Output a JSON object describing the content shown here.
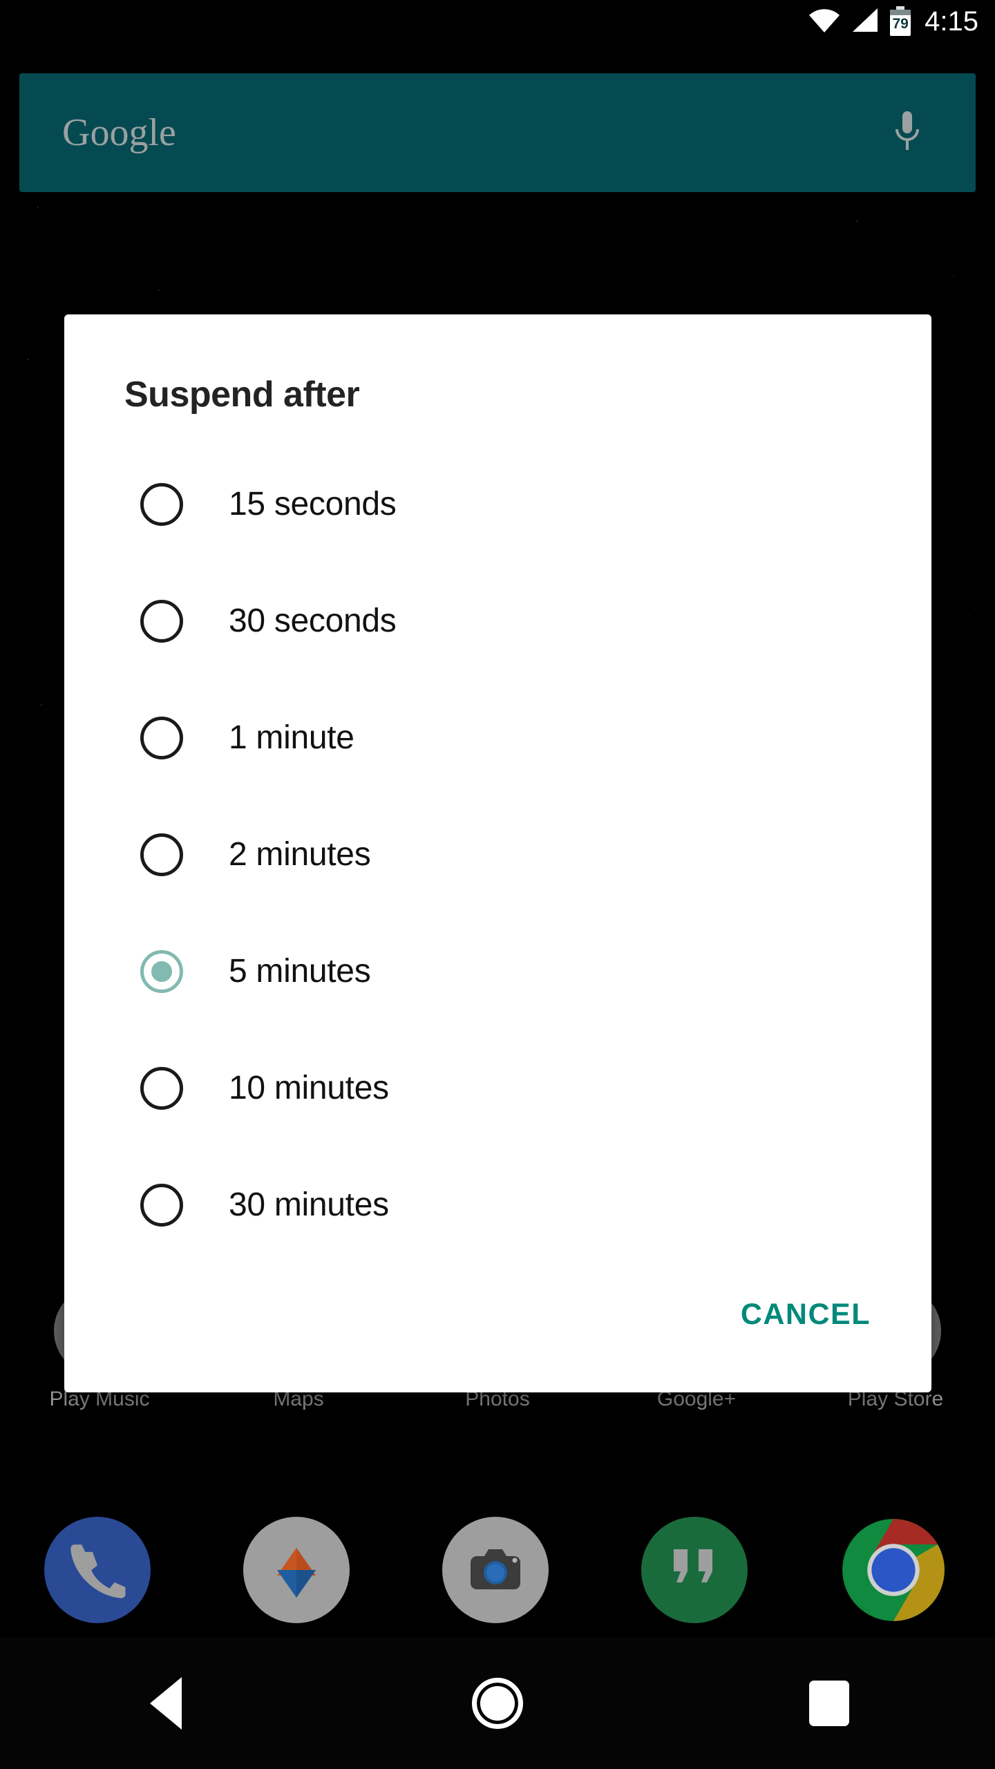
{
  "status_bar": {
    "wifi_icon": "wifi-icon",
    "signal_icon": "cell-signal-icon",
    "battery_icon": "battery-icon",
    "battery_level": "79",
    "time": "4:15"
  },
  "search": {
    "logo_text": "Google",
    "mic_icon": "microphone-icon",
    "accent_color": "#07545C"
  },
  "dialog": {
    "title": "Suspend after",
    "selected_index": 4,
    "options": [
      {
        "label": "15 seconds",
        "selected": false
      },
      {
        "label": "30 seconds",
        "selected": false
      },
      {
        "label": "1 minute",
        "selected": false
      },
      {
        "label": "2 minutes",
        "selected": false
      },
      {
        "label": "5 minutes",
        "selected": true
      },
      {
        "label": "10 minutes",
        "selected": false
      },
      {
        "label": "30 minutes",
        "selected": false
      }
    ],
    "cancel_label": "CANCEL",
    "cancel_color": "#00897B",
    "selected_radio_color": "#82B9B0"
  },
  "home_apps": [
    {
      "label": "Play Music"
    },
    {
      "label": "Maps"
    },
    {
      "label": "Photos"
    },
    {
      "label": "Google+"
    },
    {
      "label": "Play Store"
    }
  ],
  "dock": [
    {
      "name": "phone",
      "icon": "phone-icon",
      "color": "#2a4a96"
    },
    {
      "name": "photos",
      "icon": "photos-icon",
      "color": "#9e9e9e"
    },
    {
      "name": "camera",
      "icon": "camera-icon",
      "color": "#9e9e9e"
    },
    {
      "name": "hangouts",
      "icon": "hangouts-icon",
      "color": "#1a6b3c"
    },
    {
      "name": "chrome",
      "icon": "chrome-icon",
      "color": "#dd4b39"
    }
  ],
  "nav_bar": {
    "back_icon": "back-triangle-icon",
    "home_icon": "home-circle-icon",
    "recents_icon": "recents-square-icon"
  }
}
